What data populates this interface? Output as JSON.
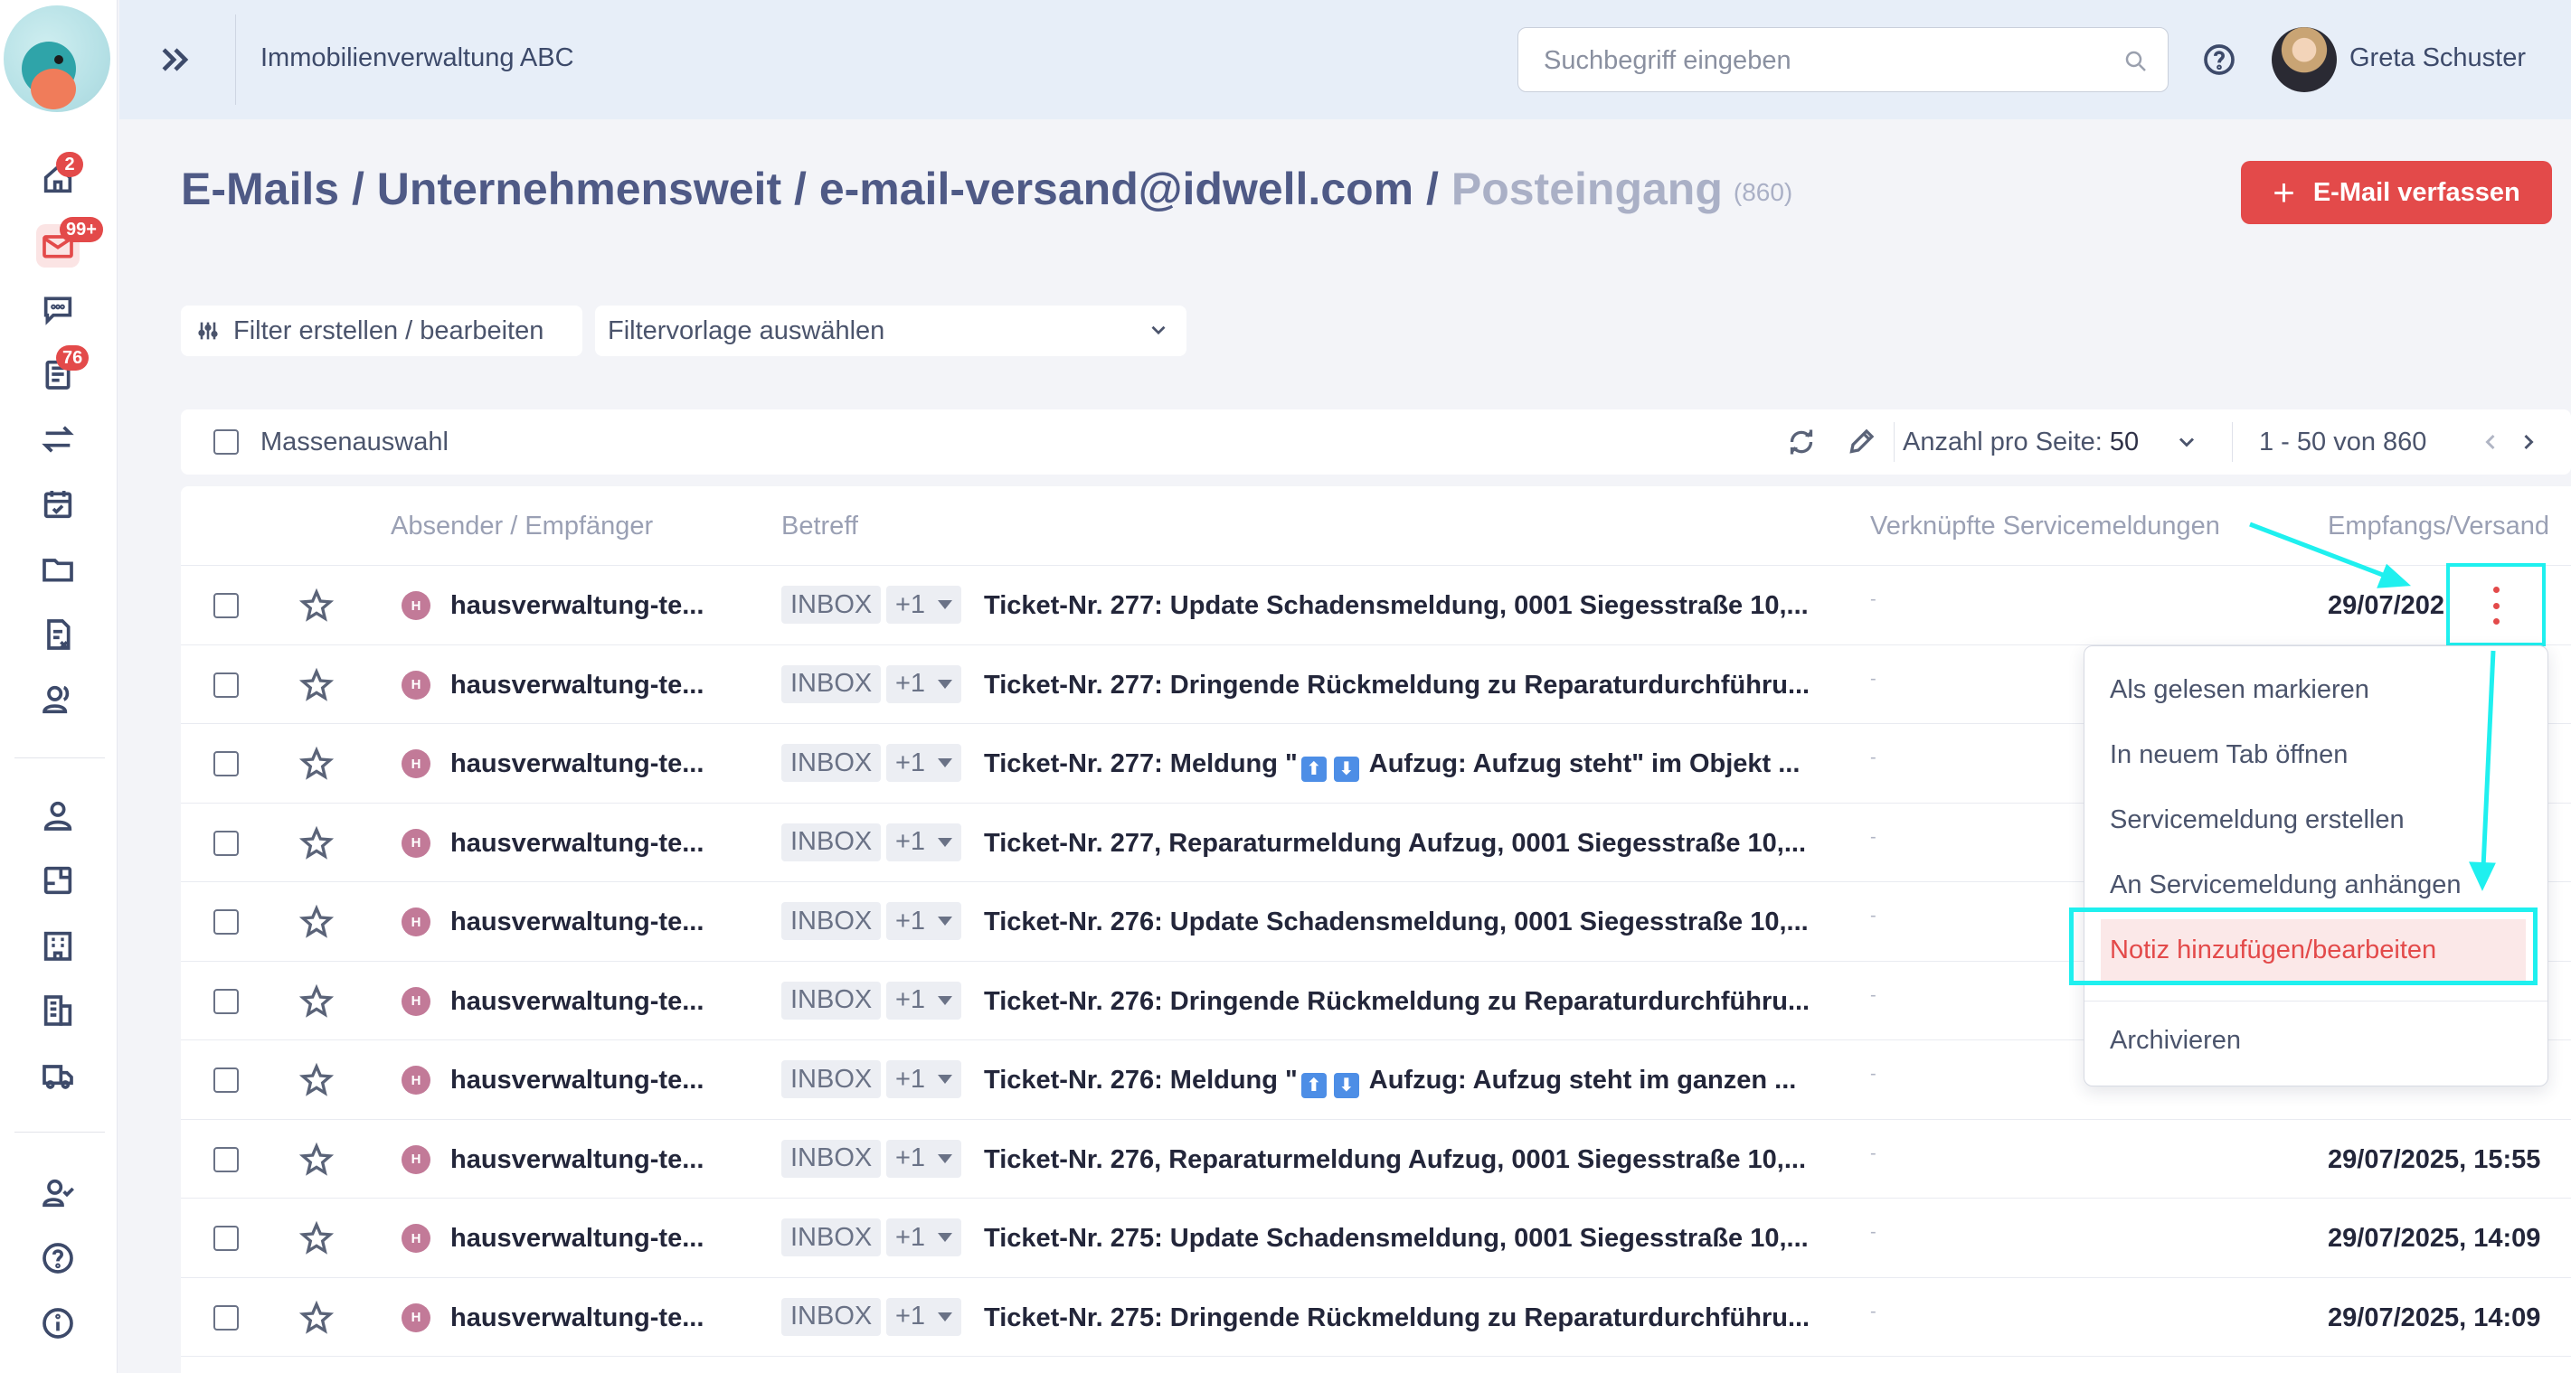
{
  "app": {
    "company": "Immobilienverwaltung ABC",
    "search_placeholder": "Suchbegriff eingeben",
    "user_name": "Greta Schuster"
  },
  "sidebar": {
    "badges": {
      "home": "2",
      "mail": "99+",
      "tickets": "76"
    }
  },
  "breadcrumb": {
    "part1": "E-Mails",
    "sep": "/",
    "part2": "Unternehmensweit",
    "part3": "e-mail-versand@idwell.com",
    "current": "Posteingang",
    "count": "(860)"
  },
  "compose_label": "E-Mail verfassen",
  "filters": {
    "edit_label": "Filter erstellen / bearbeiten",
    "preset_placeholder": "Filtervorlage auswählen"
  },
  "toolbar": {
    "mass_select": "Massenauswahl",
    "per_page_label": "Anzahl pro Seite:",
    "per_page_value": "50",
    "range": "1 - 50 von 860"
  },
  "columns": {
    "sender": "Absender / Empfänger",
    "subject": "Betreff",
    "linked": "Verknüpfte Servicemeldungen",
    "date": "Empfangs/Versand"
  },
  "rows": [
    {
      "avatar": "H",
      "sender": "hausverwaltung-te...",
      "folder": "INBOX",
      "extra": "+1",
      "subject": "Ticket-Nr. 277: Update Schadensmeldung, 0001 Siegesstraße 10,...",
      "linked": "-",
      "date": "29/07/202"
    },
    {
      "avatar": "H",
      "sender": "hausverwaltung-te...",
      "folder": "INBOX",
      "extra": "+1",
      "subject": "Ticket-Nr. 277: Dringende Rückmeldung zu Reparaturdurchführu...",
      "linked": "-",
      "date": ""
    },
    {
      "avatar": "H",
      "sender": "hausverwaltung-te...",
      "folder": "INBOX",
      "extra": "+1",
      "subject_pre": "Ticket-Nr. 277: Meldung \"",
      "subject_post": " Aufzug: Aufzug steht\" im Objekt ...",
      "linked": "-",
      "date": ""
    },
    {
      "avatar": "H",
      "sender": "hausverwaltung-te...",
      "folder": "INBOX",
      "extra": "+1",
      "subject": "Ticket-Nr. 277, Reparaturmeldung Aufzug, 0001 Siegesstraße 10,...",
      "linked": "-",
      "date": ""
    },
    {
      "avatar": "H",
      "sender": "hausverwaltung-te...",
      "folder": "INBOX",
      "extra": "+1",
      "subject": "Ticket-Nr. 276: Update Schadensmeldung, 0001 Siegesstraße 10,...",
      "linked": "-",
      "date": ""
    },
    {
      "avatar": "H",
      "sender": "hausverwaltung-te...",
      "folder": "INBOX",
      "extra": "+1",
      "subject": "Ticket-Nr. 276: Dringende Rückmeldung zu Reparaturdurchführu...",
      "linked": "-",
      "date": ""
    },
    {
      "avatar": "H",
      "sender": "hausverwaltung-te...",
      "folder": "INBOX",
      "extra": "+1",
      "subject_pre": "Ticket-Nr. 276: Meldung \"",
      "subject_post": " Aufzug: Aufzug steht im ganzen ...",
      "linked": "-",
      "date": ""
    },
    {
      "avatar": "H",
      "sender": "hausverwaltung-te...",
      "folder": "INBOX",
      "extra": "+1",
      "subject": "Ticket-Nr. 276, Reparaturmeldung Aufzug, 0001 Siegesstraße 10,...",
      "linked": "-",
      "date": "29/07/2025, 15:55"
    },
    {
      "avatar": "H",
      "sender": "hausverwaltung-te...",
      "folder": "INBOX",
      "extra": "+1",
      "subject": "Ticket-Nr. 275: Update Schadensmeldung, 0001 Siegesstraße 10,...",
      "linked": "-",
      "date": "29/07/2025, 14:09"
    },
    {
      "avatar": "H",
      "sender": "hausverwaltung-te...",
      "folder": "INBOX",
      "extra": "+1",
      "subject": "Ticket-Nr. 275: Dringende Rückmeldung zu Reparaturdurchführu...",
      "linked": "-",
      "date": "29/07/2025, 14:09"
    }
  ],
  "context_menu": {
    "mark_read": "Als gelesen markieren",
    "open_tab": "In neuem Tab öffnen",
    "create_service": "Servicemeldung erstellen",
    "attach_service": "An Servicemeldung anhängen",
    "note": "Notiz hinzufügen/bearbeiten",
    "archive": "Archivieren"
  },
  "colors": {
    "accent": "#e34a4a",
    "annotation": "#1ff0ef",
    "topbar": "#e7eef8"
  }
}
